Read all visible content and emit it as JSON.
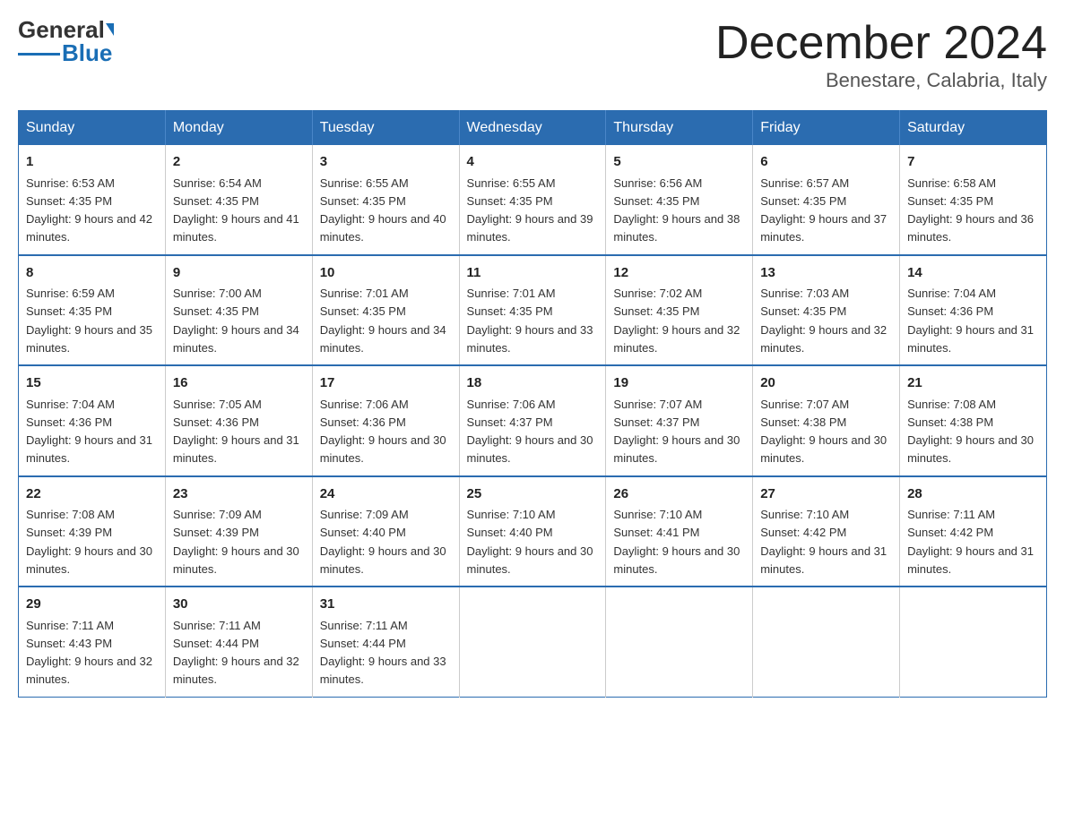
{
  "logo": {
    "text_general": "General",
    "text_blue": "Blue"
  },
  "title": "December 2024",
  "location": "Benestare, Calabria, Italy",
  "days_of_week": [
    "Sunday",
    "Monday",
    "Tuesday",
    "Wednesday",
    "Thursday",
    "Friday",
    "Saturday"
  ],
  "weeks": [
    [
      {
        "day": "1",
        "sunrise": "6:53 AM",
        "sunset": "4:35 PM",
        "daylight": "9 hours and 42 minutes."
      },
      {
        "day": "2",
        "sunrise": "6:54 AM",
        "sunset": "4:35 PM",
        "daylight": "9 hours and 41 minutes."
      },
      {
        "day": "3",
        "sunrise": "6:55 AM",
        "sunset": "4:35 PM",
        "daylight": "9 hours and 40 minutes."
      },
      {
        "day": "4",
        "sunrise": "6:55 AM",
        "sunset": "4:35 PM",
        "daylight": "9 hours and 39 minutes."
      },
      {
        "day": "5",
        "sunrise": "6:56 AM",
        "sunset": "4:35 PM",
        "daylight": "9 hours and 38 minutes."
      },
      {
        "day": "6",
        "sunrise": "6:57 AM",
        "sunset": "4:35 PM",
        "daylight": "9 hours and 37 minutes."
      },
      {
        "day": "7",
        "sunrise": "6:58 AM",
        "sunset": "4:35 PM",
        "daylight": "9 hours and 36 minutes."
      }
    ],
    [
      {
        "day": "8",
        "sunrise": "6:59 AM",
        "sunset": "4:35 PM",
        "daylight": "9 hours and 35 minutes."
      },
      {
        "day": "9",
        "sunrise": "7:00 AM",
        "sunset": "4:35 PM",
        "daylight": "9 hours and 34 minutes."
      },
      {
        "day": "10",
        "sunrise": "7:01 AM",
        "sunset": "4:35 PM",
        "daylight": "9 hours and 34 minutes."
      },
      {
        "day": "11",
        "sunrise": "7:01 AM",
        "sunset": "4:35 PM",
        "daylight": "9 hours and 33 minutes."
      },
      {
        "day": "12",
        "sunrise": "7:02 AM",
        "sunset": "4:35 PM",
        "daylight": "9 hours and 32 minutes."
      },
      {
        "day": "13",
        "sunrise": "7:03 AM",
        "sunset": "4:35 PM",
        "daylight": "9 hours and 32 minutes."
      },
      {
        "day": "14",
        "sunrise": "7:04 AM",
        "sunset": "4:36 PM",
        "daylight": "9 hours and 31 minutes."
      }
    ],
    [
      {
        "day": "15",
        "sunrise": "7:04 AM",
        "sunset": "4:36 PM",
        "daylight": "9 hours and 31 minutes."
      },
      {
        "day": "16",
        "sunrise": "7:05 AM",
        "sunset": "4:36 PM",
        "daylight": "9 hours and 31 minutes."
      },
      {
        "day": "17",
        "sunrise": "7:06 AM",
        "sunset": "4:36 PM",
        "daylight": "9 hours and 30 minutes."
      },
      {
        "day": "18",
        "sunrise": "7:06 AM",
        "sunset": "4:37 PM",
        "daylight": "9 hours and 30 minutes."
      },
      {
        "day": "19",
        "sunrise": "7:07 AM",
        "sunset": "4:37 PM",
        "daylight": "9 hours and 30 minutes."
      },
      {
        "day": "20",
        "sunrise": "7:07 AM",
        "sunset": "4:38 PM",
        "daylight": "9 hours and 30 minutes."
      },
      {
        "day": "21",
        "sunrise": "7:08 AM",
        "sunset": "4:38 PM",
        "daylight": "9 hours and 30 minutes."
      }
    ],
    [
      {
        "day": "22",
        "sunrise": "7:08 AM",
        "sunset": "4:39 PM",
        "daylight": "9 hours and 30 minutes."
      },
      {
        "day": "23",
        "sunrise": "7:09 AM",
        "sunset": "4:39 PM",
        "daylight": "9 hours and 30 minutes."
      },
      {
        "day": "24",
        "sunrise": "7:09 AM",
        "sunset": "4:40 PM",
        "daylight": "9 hours and 30 minutes."
      },
      {
        "day": "25",
        "sunrise": "7:10 AM",
        "sunset": "4:40 PM",
        "daylight": "9 hours and 30 minutes."
      },
      {
        "day": "26",
        "sunrise": "7:10 AM",
        "sunset": "4:41 PM",
        "daylight": "9 hours and 30 minutes."
      },
      {
        "day": "27",
        "sunrise": "7:10 AM",
        "sunset": "4:42 PM",
        "daylight": "9 hours and 31 minutes."
      },
      {
        "day": "28",
        "sunrise": "7:11 AM",
        "sunset": "4:42 PM",
        "daylight": "9 hours and 31 minutes."
      }
    ],
    [
      {
        "day": "29",
        "sunrise": "7:11 AM",
        "sunset": "4:43 PM",
        "daylight": "9 hours and 32 minutes."
      },
      {
        "day": "30",
        "sunrise": "7:11 AM",
        "sunset": "4:44 PM",
        "daylight": "9 hours and 32 minutes."
      },
      {
        "day": "31",
        "sunrise": "7:11 AM",
        "sunset": "4:44 PM",
        "daylight": "9 hours and 33 minutes."
      },
      null,
      null,
      null,
      null
    ]
  ]
}
